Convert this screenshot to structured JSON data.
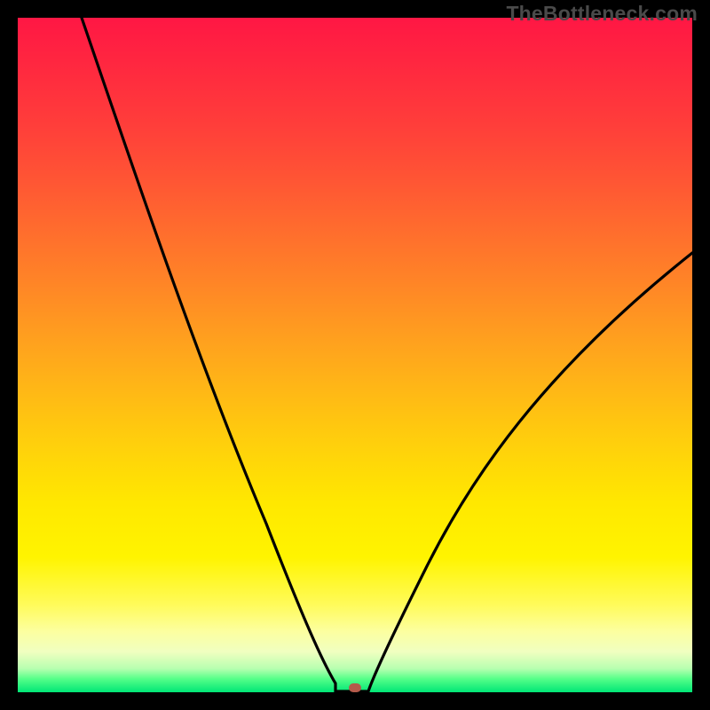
{
  "watermark": "TheBottleneck.com",
  "chart_data": {
    "type": "line",
    "title": "",
    "xlabel": "",
    "ylabel": "",
    "x": [
      0.0,
      0.05,
      0.1,
      0.15,
      0.2,
      0.25,
      0.3,
      0.35,
      0.4,
      0.43,
      0.46,
      0.48,
      0.5,
      0.52,
      0.56,
      0.6,
      0.65,
      0.7,
      0.8,
      0.9,
      1.0
    ],
    "values": [
      1.0,
      0.9,
      0.8,
      0.7,
      0.6,
      0.5,
      0.4,
      0.3,
      0.18,
      0.08,
      0.02,
      0.0,
      0.0,
      0.01,
      0.05,
      0.12,
      0.22,
      0.32,
      0.48,
      0.58,
      0.65
    ],
    "xlim": [
      0,
      1
    ],
    "ylim": [
      0,
      1
    ],
    "marker": {
      "x": 0.5,
      "y": 0.0
    },
    "colors": {
      "curve": "#000000",
      "marker": "#b45a4a",
      "gradient_top": "#ff1744",
      "gradient_bottom": "#00e676"
    },
    "grid": false,
    "legend_position": "none"
  }
}
